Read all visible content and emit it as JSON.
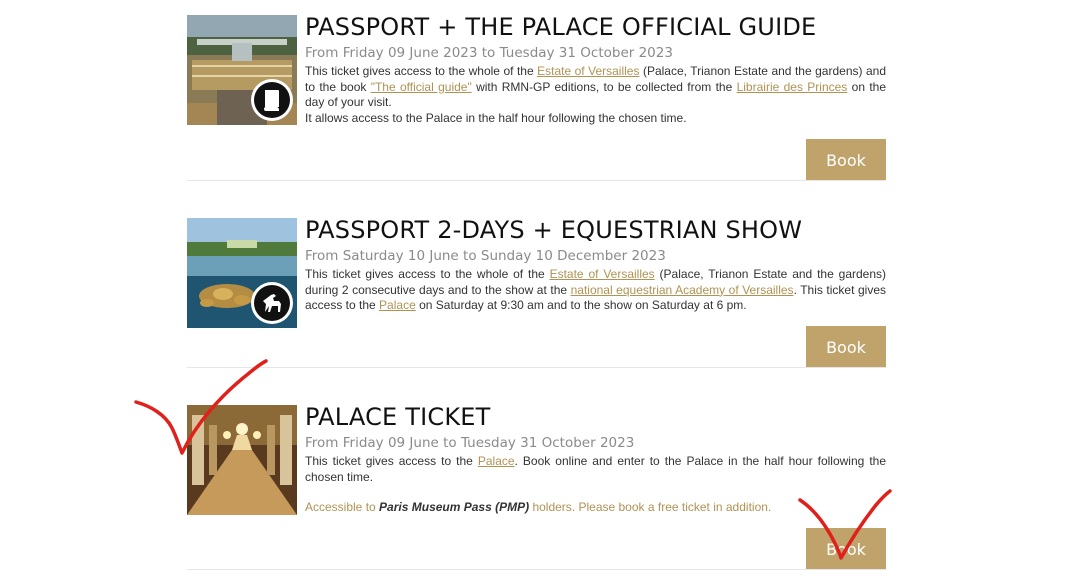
{
  "tickets": [
    {
      "title": "PASSPORT + THE PALACE OFFICIAL GUIDE",
      "dates": "From Friday 09 June 2023 to Tuesday 31 October 2023",
      "desc": {
        "t1": "This ticket gives access to the whole of the ",
        "link1": "Estate of Versailles",
        "t2": " (Palace, Trianon Estate and the gardens) and to the book ",
        "link2": "\"The official guide\"",
        "t3": " with RMN-GP editions, to be collected from the ",
        "link3": "Librairie des Princes",
        "t4": " on the day of your visit.",
        "t5": "It allows access to the Palace in the half hour following the chosen time."
      },
      "badge_icon": "book-icon",
      "book_label": "Book"
    },
    {
      "title": "PASSPORT 2-DAYS + EQUESTRIAN SHOW",
      "dates": "From Saturday 10 June to Sunday 10 December 2023",
      "desc": {
        "t1": "This ticket gives access to the whole of the ",
        "link1": "Estate of Versailles",
        "t2": " (Palace, Trianon Estate and the gardens) during 2 consecutive days and to the show at the ",
        "link2": "national equestrian Academy of Versailles",
        "t3": ". This ticket gives access to the ",
        "link3": "Palace",
        "t4": " on Saturday at 9:30 am and to the show on Saturday at 6 pm."
      },
      "badge_icon": "horse-icon",
      "book_label": "Book"
    },
    {
      "title": "PALACE TICKET",
      "dates": "From Friday 09 June to Tuesday 31 October 2023",
      "desc": {
        "t1": "This ticket gives access to the ",
        "link1": "Palace",
        "t2": ". Book online and enter to the Palace in the half hour following the chosen time."
      },
      "note": {
        "t1": "Accessible to ",
        "em": "Paris Museum Pass (PMP)",
        "t2": " holders. Please book a free ticket in addition."
      },
      "book_label": "Book"
    }
  ],
  "colors": {
    "accent": "#bfa36b",
    "link": "#b09253",
    "annotation": "#e0201b"
  }
}
